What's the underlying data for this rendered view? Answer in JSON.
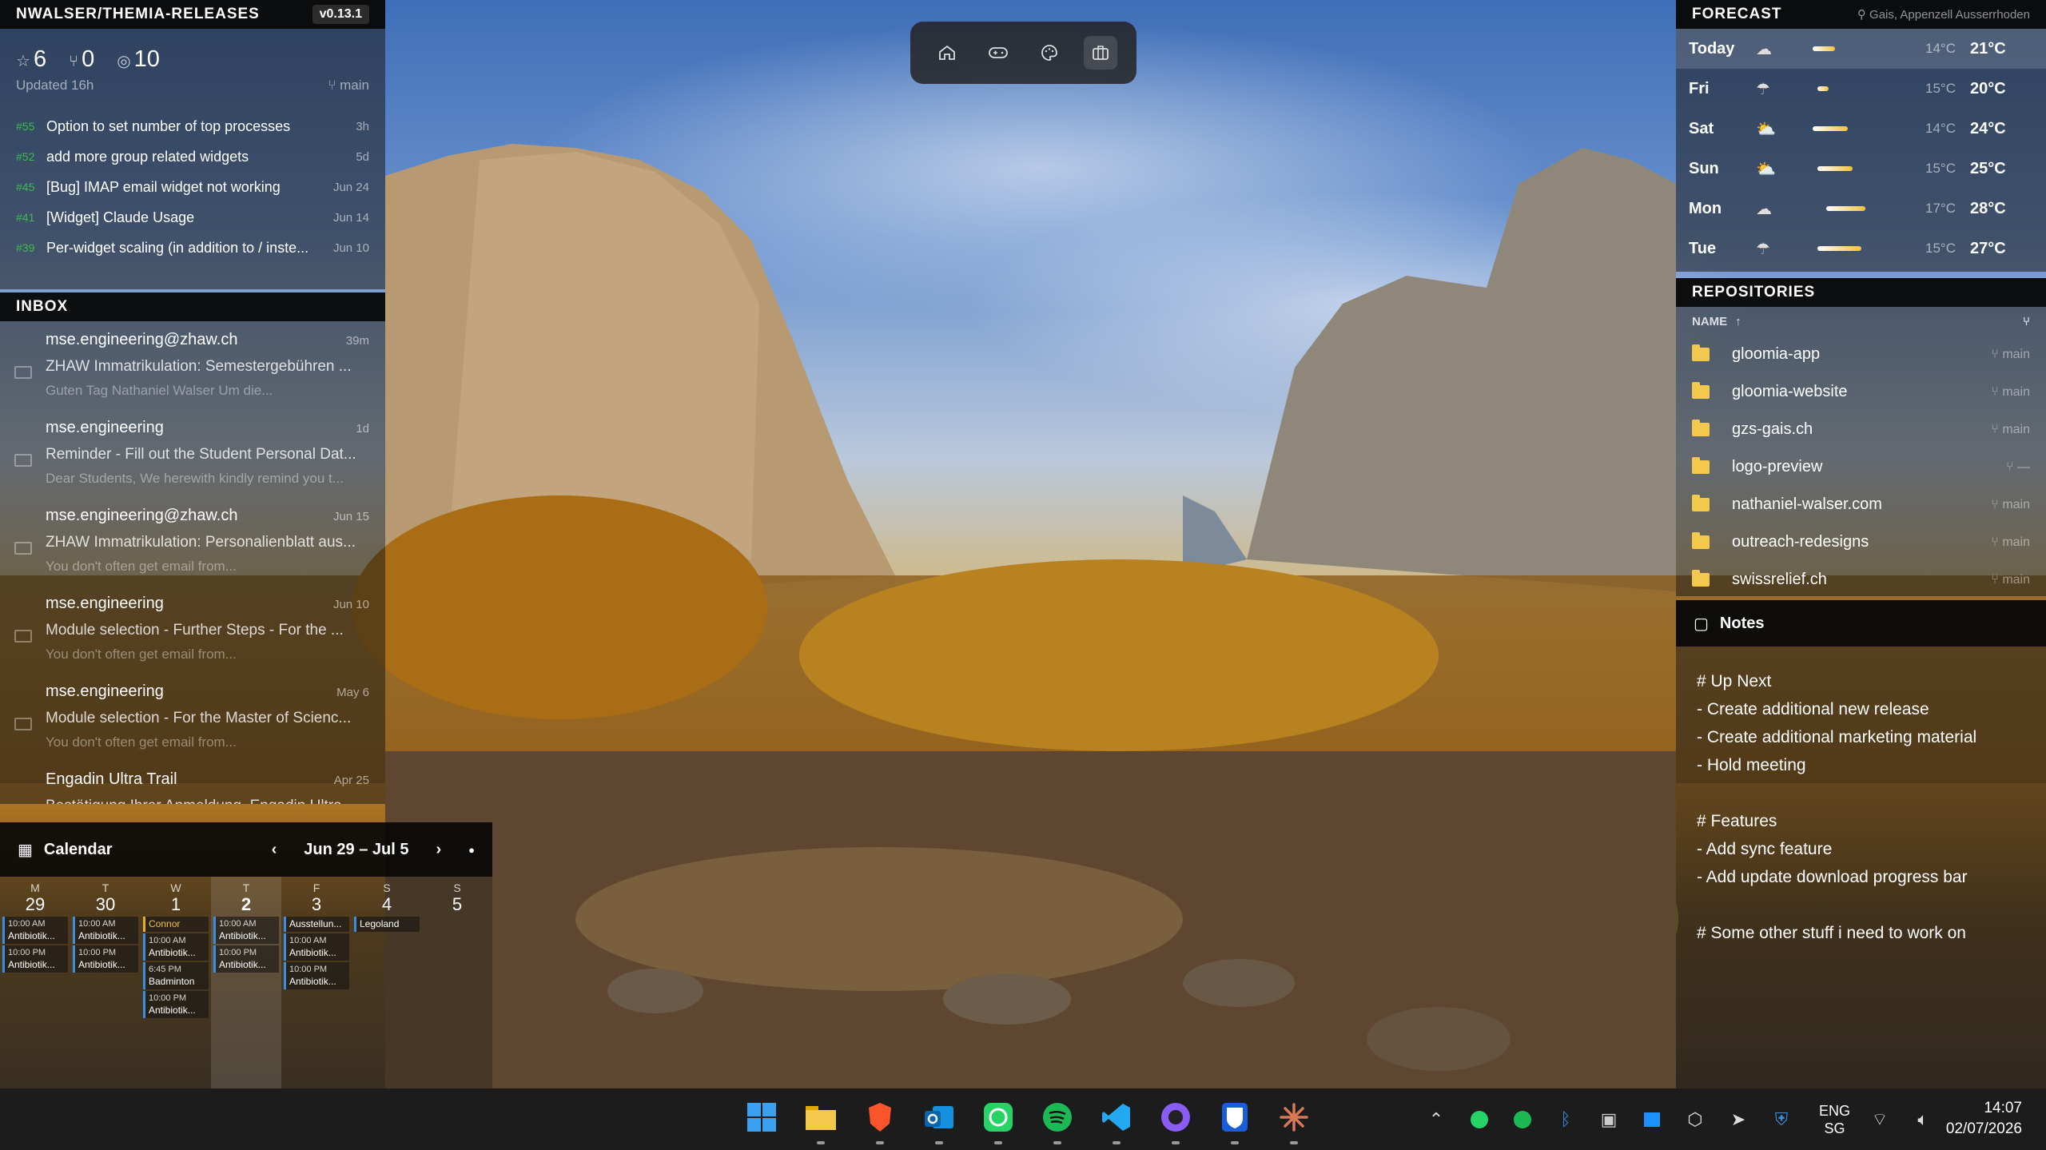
{
  "release": {
    "title": "NWALSER/THEMIA-RELEASES",
    "version": "v0.13.1",
    "stars": "6",
    "forks": "0",
    "watchers": "10",
    "updated": "Updated 16h",
    "branch": "main",
    "issues": [
      {
        "num": "#55",
        "title": "Option to set number of top processes",
        "date": "3h"
      },
      {
        "num": "#52",
        "title": "add more group related widgets",
        "date": "5d"
      },
      {
        "num": "#45",
        "title": "[Bug] IMAP email widget not working",
        "date": "Jun 24"
      },
      {
        "num": "#41",
        "title": "[Widget] Claude Usage",
        "date": "Jun 14"
      },
      {
        "num": "#39",
        "title": "Per-widget scaling (in addition to / inste...",
        "date": "Jun 10"
      }
    ]
  },
  "inbox": {
    "title": "INBOX",
    "mails": [
      {
        "from": "mse.engineering@zhaw.ch",
        "date": "39m",
        "subject": "ZHAW Immatrikulation: Semestergebühren ...",
        "preview": "Guten Tag Nathaniel Walser Um die..."
      },
      {
        "from": "mse.engineering",
        "date": "1d",
        "subject": "Reminder - Fill out the Student Personal Dat...",
        "preview": "Dear Students, We herewith kindly remind you t..."
      },
      {
        "from": "mse.engineering@zhaw.ch",
        "date": "Jun 15",
        "subject": "ZHAW Immatrikulation: Personalienblatt aus...",
        "preview": "You don't often get email from..."
      },
      {
        "from": "mse.engineering",
        "date": "Jun 10",
        "subject": "Module selection - Further Steps - For the ...",
        "preview": "You don't often get email from..."
      },
      {
        "from": "mse.engineering",
        "date": "May 6",
        "subject": "Module selection - For the Master of Scienc...",
        "preview": "You don't often get email from..."
      },
      {
        "from": "Engadin Ultra Trail",
        "date": "Apr 25",
        "subject": "Bestätigung Ihrer Anmeldung, Engadin Ultra...",
        "preview": ""
      }
    ]
  },
  "calendar": {
    "title": "Calendar",
    "range": "Jun 29 – Jul 5",
    "prev": "‹",
    "next": "›",
    "todayDot": "●",
    "days": [
      {
        "l": "M",
        "n": "29",
        "events": [
          {
            "t": "10:00 AM",
            "n": "Antibiotik..."
          },
          {
            "t": "10:00 PM",
            "n": "Antibiotik..."
          }
        ]
      },
      {
        "l": "T",
        "n": "30",
        "events": [
          {
            "t": "10:00 AM",
            "n": "Antibiotik..."
          },
          {
            "t": "10:00 PM",
            "n": "Antibiotik..."
          }
        ]
      },
      {
        "l": "W",
        "n": "1",
        "events": [
          {
            "t": "",
            "n": "Connor",
            "y": true
          },
          {
            "t": "10:00 AM",
            "n": "Antibiotik..."
          },
          {
            "t": "6:45 PM",
            "n": "Badminton"
          },
          {
            "t": "10:00 PM",
            "n": "Antibiotik..."
          }
        ]
      },
      {
        "l": "T",
        "n": "2",
        "today": true,
        "events": [
          {
            "t": "10:00 AM",
            "n": "Antibiotik..."
          },
          {
            "t": "10:00 PM",
            "n": "Antibiotik..."
          }
        ]
      },
      {
        "l": "F",
        "n": "3",
        "events": [
          {
            "t": "",
            "n": "Ausstellun..."
          },
          {
            "t": "10:00 AM",
            "n": "Antibiotik..."
          },
          {
            "t": "10:00 PM",
            "n": "Antibiotik..."
          }
        ]
      },
      {
        "l": "S",
        "n": "4",
        "events": [
          {
            "t": "",
            "n": "Legoland"
          }
        ]
      },
      {
        "l": "S",
        "n": "5",
        "events": []
      }
    ]
  },
  "forecast": {
    "title": "FORECAST",
    "location": "Gais, Appenzell Ausserrhoden",
    "days": [
      {
        "day": "Today",
        "lo": "14°C",
        "hi": "21°C",
        "icon": "cloud",
        "s": 0.1,
        "e": 0.35
      },
      {
        "day": "Fri",
        "lo": "15°C",
        "hi": "20°C",
        "icon": "rain",
        "s": 0.15,
        "e": 0.28
      },
      {
        "day": "Sat",
        "lo": "14°C",
        "hi": "24°C",
        "icon": "sun-cloud",
        "s": 0.1,
        "e": 0.5
      },
      {
        "day": "Sun",
        "lo": "15°C",
        "hi": "25°C",
        "icon": "sun-cloud",
        "s": 0.15,
        "e": 0.55
      },
      {
        "day": "Mon",
        "lo": "17°C",
        "hi": "28°C",
        "icon": "cloud",
        "s": 0.25,
        "e": 0.7
      },
      {
        "day": "Tue",
        "lo": "15°C",
        "hi": "27°C",
        "icon": "rain",
        "s": 0.15,
        "e": 0.65
      }
    ]
  },
  "repos": {
    "title": "REPOSITORIES",
    "col": "NAME",
    "list": [
      {
        "name": "gloomia-app",
        "branch": "main"
      },
      {
        "name": "gloomia-website",
        "branch": "main"
      },
      {
        "name": "gzs-gais.ch",
        "branch": "main"
      },
      {
        "name": "logo-preview",
        "branch": "—"
      },
      {
        "name": "nathaniel-walser.com",
        "branch": "main"
      },
      {
        "name": "outreach-redesigns",
        "branch": "main"
      },
      {
        "name": "swissrelief.ch",
        "branch": "main"
      }
    ]
  },
  "notes": {
    "title": "Notes",
    "lines": [
      "# Up Next",
      "- Create additional new release",
      "- Create additional marketing material",
      "- Hold meeting",
      "",
      "# Features",
      "- Add sync feature",
      "- Add update download progress bar",
      "",
      "# Some other stuff i need to work on"
    ]
  },
  "taskbar": {
    "lang": "ENG",
    "region": "SG",
    "time": "14:07",
    "date": "02/07/2026",
    "apps": [
      "windows-start-icon",
      "file-explorer-icon",
      "brave-icon",
      "outlook-icon",
      "whatsapp-icon",
      "spotify-icon",
      "vscode-icon",
      "github-icon",
      "bitwarden-icon",
      "claude-icon"
    ]
  }
}
